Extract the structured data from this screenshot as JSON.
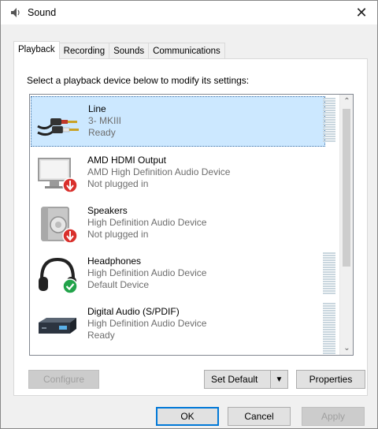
{
  "window": {
    "title": "Sound"
  },
  "tabs": [
    {
      "label": "Playback"
    },
    {
      "label": "Recording"
    },
    {
      "label": "Sounds"
    },
    {
      "label": "Communications"
    }
  ],
  "instruction": "Select a playback device below to modify its settings:",
  "devices": [
    {
      "name": "Line",
      "description": "3- MKIII",
      "status": "Ready",
      "icon": "rca-cable-icon",
      "selected": true
    },
    {
      "name": "AMD HDMI Output",
      "description": "AMD High Definition Audio Device",
      "status": "Not plugged in",
      "icon": "monitor-icon",
      "badge": "unplugged"
    },
    {
      "name": "Speakers",
      "description": "High Definition Audio Device",
      "status": "Not plugged in",
      "icon": "speaker-icon",
      "badge": "unplugged"
    },
    {
      "name": "Headphones",
      "description": "High Definition Audio Device",
      "status": "Default Device",
      "icon": "headphones-icon",
      "badge": "default"
    },
    {
      "name": "Digital Audio (S/PDIF)",
      "description": "High Definition Audio Device",
      "status": "Ready",
      "icon": "digital-audio-icon"
    }
  ],
  "buttons": {
    "configure": "Configure",
    "set_default": "Set Default",
    "properties": "Properties",
    "ok": "OK",
    "cancel": "Cancel",
    "apply": "Apply"
  },
  "colors": {
    "selection": "#cce8ff",
    "accent": "#0078d7",
    "unplugged_badge": "#d9302c",
    "default_badge": "#22a34a"
  }
}
